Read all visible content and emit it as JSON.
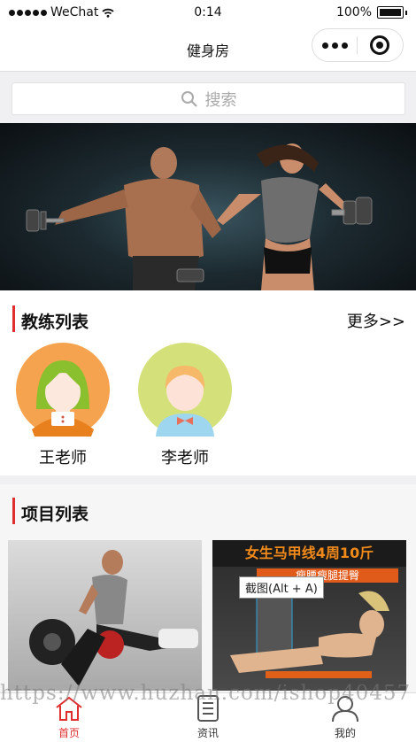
{
  "status_bar": {
    "carrier": "WeChat",
    "time": "0:14",
    "battery": "100%"
  },
  "navbar": {
    "title": "健身房"
  },
  "search": {
    "placeholder": "搜索"
  },
  "coaches_section": {
    "title": "教练列表",
    "more": "更多>>"
  },
  "coaches": [
    {
      "name": "王老师"
    },
    {
      "name": "李老师"
    }
  ],
  "projects_section": {
    "title": "项目列表"
  },
  "project_poster": {
    "headline": "女生马甲线4周10斤",
    "subline": "瘦腰瘦腿提臀"
  },
  "tooltip": "截图(Alt + A)",
  "watermark": "https://www.huzhan.com/ishop40457",
  "tabbar": [
    {
      "label": "首页",
      "icon": "home-icon",
      "active": true
    },
    {
      "label": "资讯",
      "icon": "document-icon",
      "active": false
    },
    {
      "label": "我的",
      "icon": "user-icon",
      "active": false
    }
  ],
  "colors": {
    "accent": "#e02e2e",
    "coach1_bg": "#f5a34e",
    "coach2_bg": "#d4e07a"
  }
}
